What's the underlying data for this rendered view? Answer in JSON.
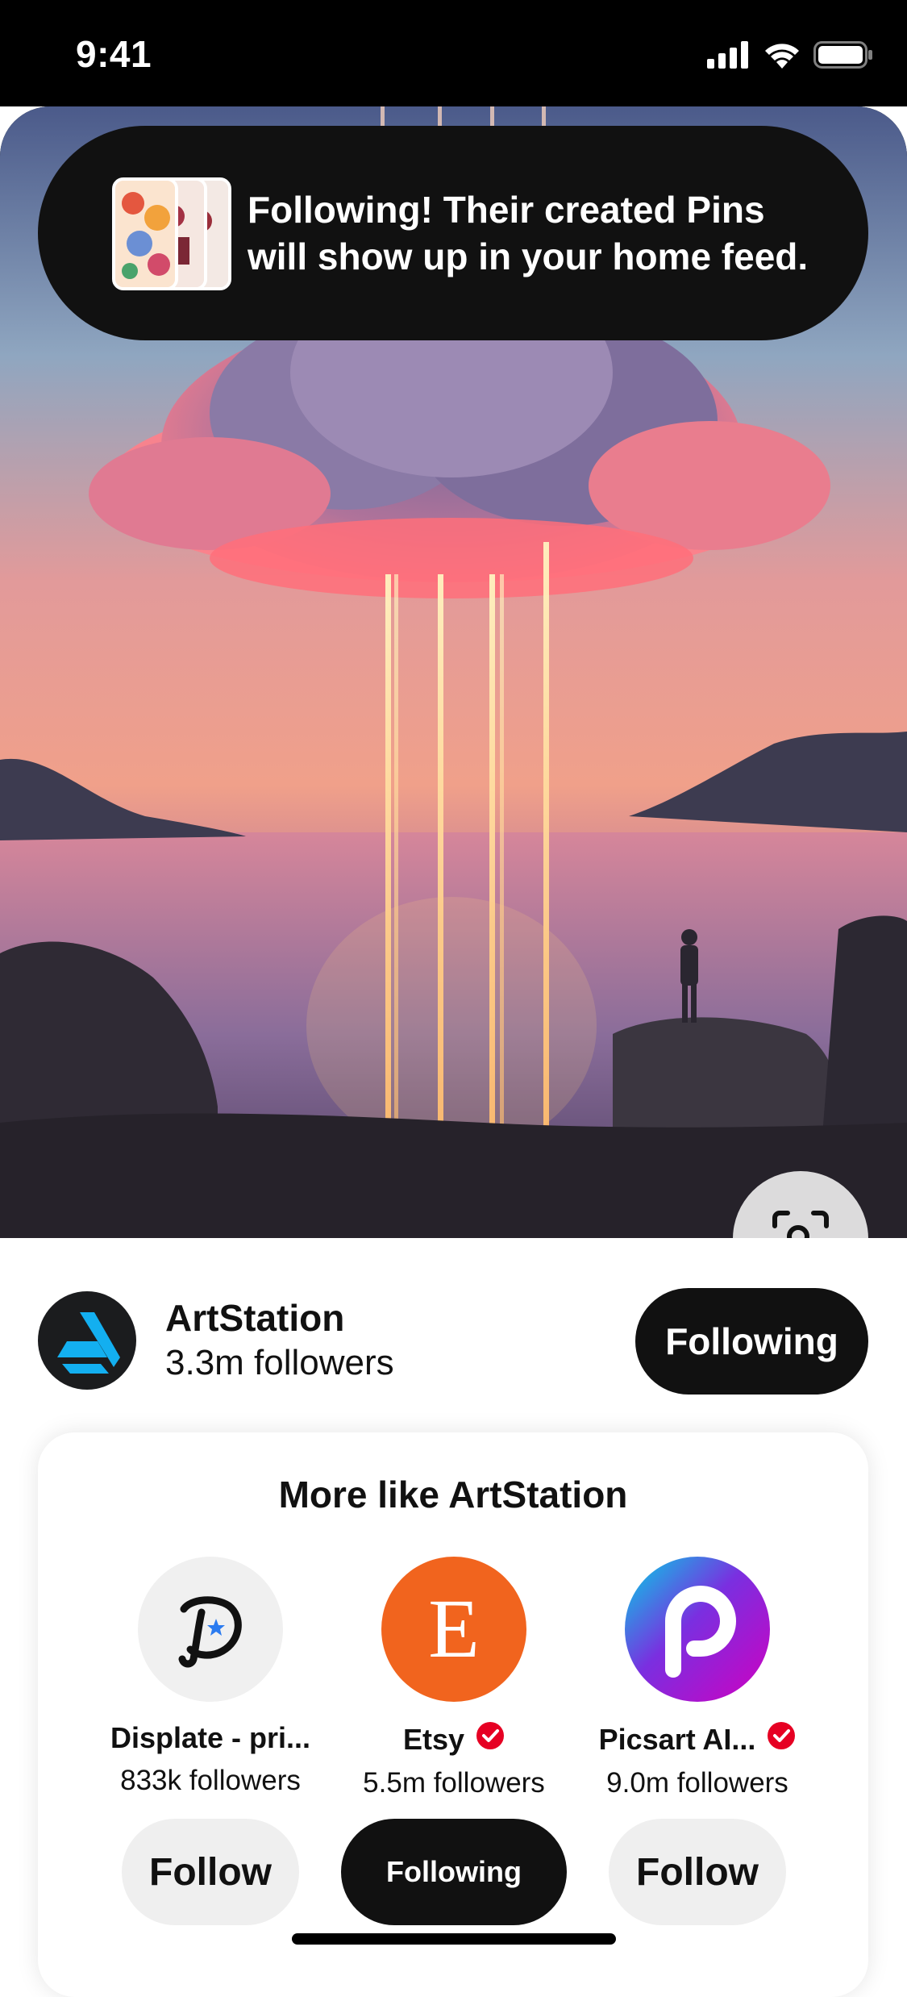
{
  "status_bar": {
    "time": "9:41"
  },
  "toast": {
    "message": "Following! Their created Pins will show up in your home feed."
  },
  "creator": {
    "name": "ArtStation",
    "followers": "3.3m followers",
    "follow_state_label": "Following"
  },
  "more_like": {
    "title": "More like ArtStation",
    "suggestions": [
      {
        "name": "Displate - pri...",
        "followers": "833k followers",
        "verified": false,
        "button_label": "Follow",
        "brand_color": "#f0f0f0"
      },
      {
        "name": "Etsy",
        "avatar_letter": "E",
        "followers": "5.5m followers",
        "verified": true,
        "button_label": "Following",
        "brand_color": "#f1641e"
      },
      {
        "name": "Picsart AI...",
        "followers": "9.0m followers",
        "verified": true,
        "button_label": "Follow",
        "brand_color": "#c209c1"
      }
    ]
  },
  "icons": {
    "signal": "cellular-signal-icon",
    "wifi": "wifi-icon",
    "battery": "battery-icon",
    "lens": "visual-search-icon",
    "verified": "verified-check-icon"
  },
  "colors": {
    "verified": "#e60023",
    "dark_button": "#111111",
    "light_button": "#efefef"
  }
}
